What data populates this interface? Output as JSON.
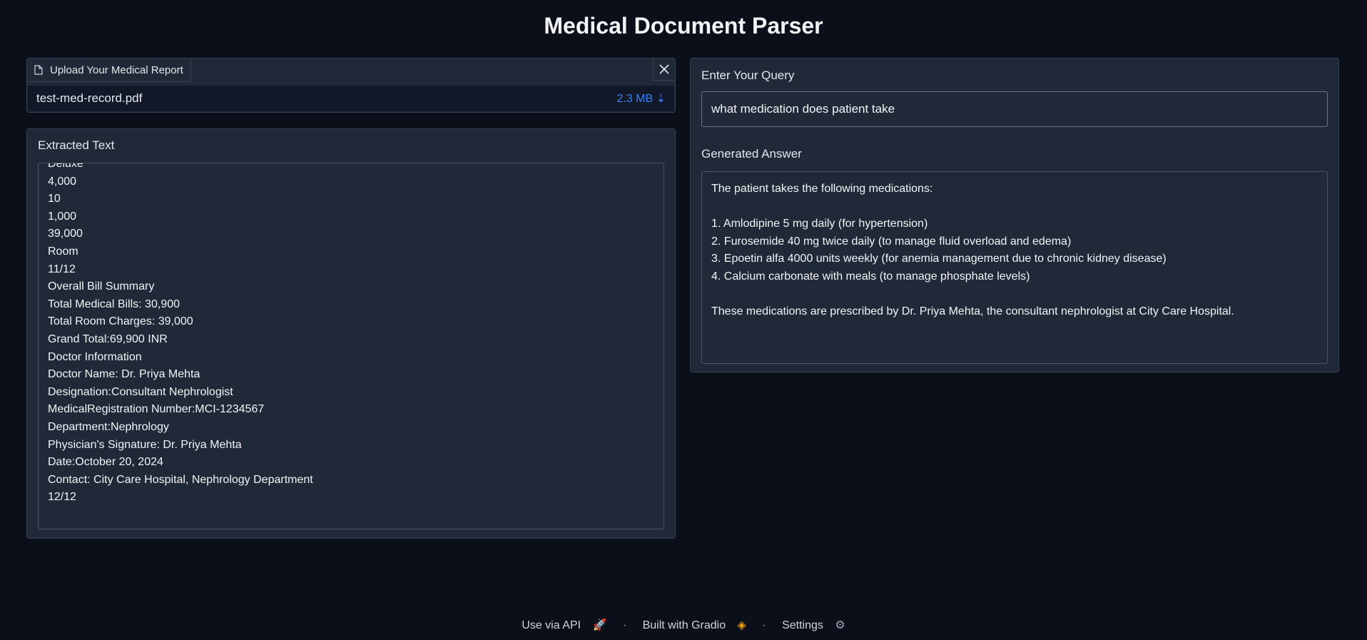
{
  "app": {
    "title": "Medical Document Parser"
  },
  "upload": {
    "label": "Upload Your Medical Report",
    "file_name": "test-med-record.pdf",
    "file_size": "2.3 MB",
    "file_icon": "file-icon",
    "close_icon": "close-icon",
    "download_icon": "download-arrow-icon"
  },
  "extracted": {
    "label": "Extracted Text",
    "lines": [
      "Deluxe",
      "4,000",
      "10",
      "1,000",
      "39,000",
      "Room",
      "11/12",
      "Overall Bill Summary",
      "Total Medical Bills: 30,900",
      "Total Room Charges: 39,000",
      "Grand Total:69,900 INR",
      "Doctor Information",
      "Doctor Name: Dr. Priya Mehta",
      "Designation:Consultant Nephrologist",
      "MedicalRegistration Number:MCI-1234567",
      "Department:Nephrology",
      "Physician's Signature: Dr. Priya Mehta",
      "Date:October 20, 2024",
      "Contact: City Care Hospital, Nephrology Department",
      "12/12"
    ]
  },
  "query": {
    "label": "Enter Your Query",
    "value": "what medication does patient take"
  },
  "answer": {
    "label": "Generated Answer",
    "lines": [
      "The patient takes the following medications:",
      "",
      "1. Amlodipine 5 mg daily (for hypertension)",
      "2. Furosemide 40 mg twice daily (to manage fluid overload and edema)",
      "3. Epoetin alfa 4000 units weekly (for anemia management due to chronic kidney disease)",
      "4. Calcium carbonate with meals (to manage phosphate levels)",
      "",
      "These medications are prescribed by Dr. Priya Mehta, the consultant nephrologist at City Care Hospital."
    ]
  },
  "footer": {
    "api": "Use via API",
    "dot": "·",
    "built": "Built with Gradio",
    "settings": "Settings"
  },
  "colors": {
    "background": "#0b0f19",
    "panel": "#1f2937",
    "accent": "#3b82f6"
  }
}
